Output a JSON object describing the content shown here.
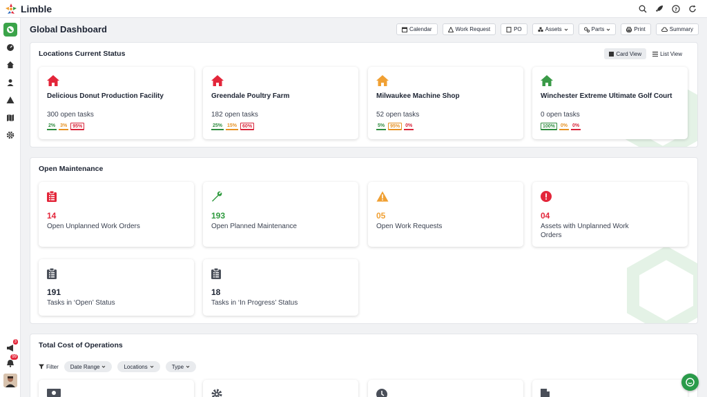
{
  "app": {
    "name": "Limble"
  },
  "header": {
    "title": "Global Dashboard",
    "toolbar": [
      "Calendar",
      "Work Request",
      "PO",
      "Assets",
      "Parts",
      "Print",
      "Summary"
    ]
  },
  "sidebar": {
    "notifications_count": "3",
    "alerts_count": "99"
  },
  "locations": {
    "title": "Locations Current Status",
    "view_card": "Card View",
    "view_list": "List View",
    "cards": [
      {
        "name": "Delicious Donut Production Facility",
        "tasks": "300 open tasks",
        "pcts": [
          "2%",
          "3%",
          "95%"
        ],
        "house_color": "#e3263a"
      },
      {
        "name": "Greendale Poultry Farm",
        "tasks": "182 open tasks",
        "pcts": [
          "25%",
          "15%",
          "60%"
        ],
        "house_color": "#e3263a"
      },
      {
        "name": "Milwaukee Machine Shop",
        "tasks": "52 open tasks",
        "pcts": [
          "5%",
          "95%",
          "0%"
        ],
        "house_color": "#f0a033"
      },
      {
        "name": "Winchester Extreme Ultimate Golf Court",
        "tasks": "0 open tasks",
        "pcts": [
          "100%",
          "0%",
          "0%"
        ],
        "house_color": "#3a9a47"
      }
    ]
  },
  "maintenance": {
    "title": "Open Maintenance",
    "cards": [
      {
        "value": "14",
        "label": "Open Unplanned Work Orders",
        "color": "#e3263a"
      },
      {
        "value": "193",
        "label": "Open Planned Maintenance",
        "color": "#2e9a3e"
      },
      {
        "value": "05",
        "label": "Open Work Requests",
        "color": "#f0a033"
      },
      {
        "value": "04",
        "label": "Assets with Unplanned Work Orders",
        "color": "#e3263a"
      },
      {
        "value": "191",
        "label": "Tasks in ‘Open’ Status",
        "color": "#1d2433"
      },
      {
        "value": "18",
        "label": "Tasks in ‘In Progress’ Status",
        "color": "#1d2433"
      }
    ]
  },
  "cost": {
    "title": "Total Cost of Operations",
    "filter_label": "Filter",
    "filters": [
      "Date Range",
      "Locations",
      "Type"
    ]
  }
}
